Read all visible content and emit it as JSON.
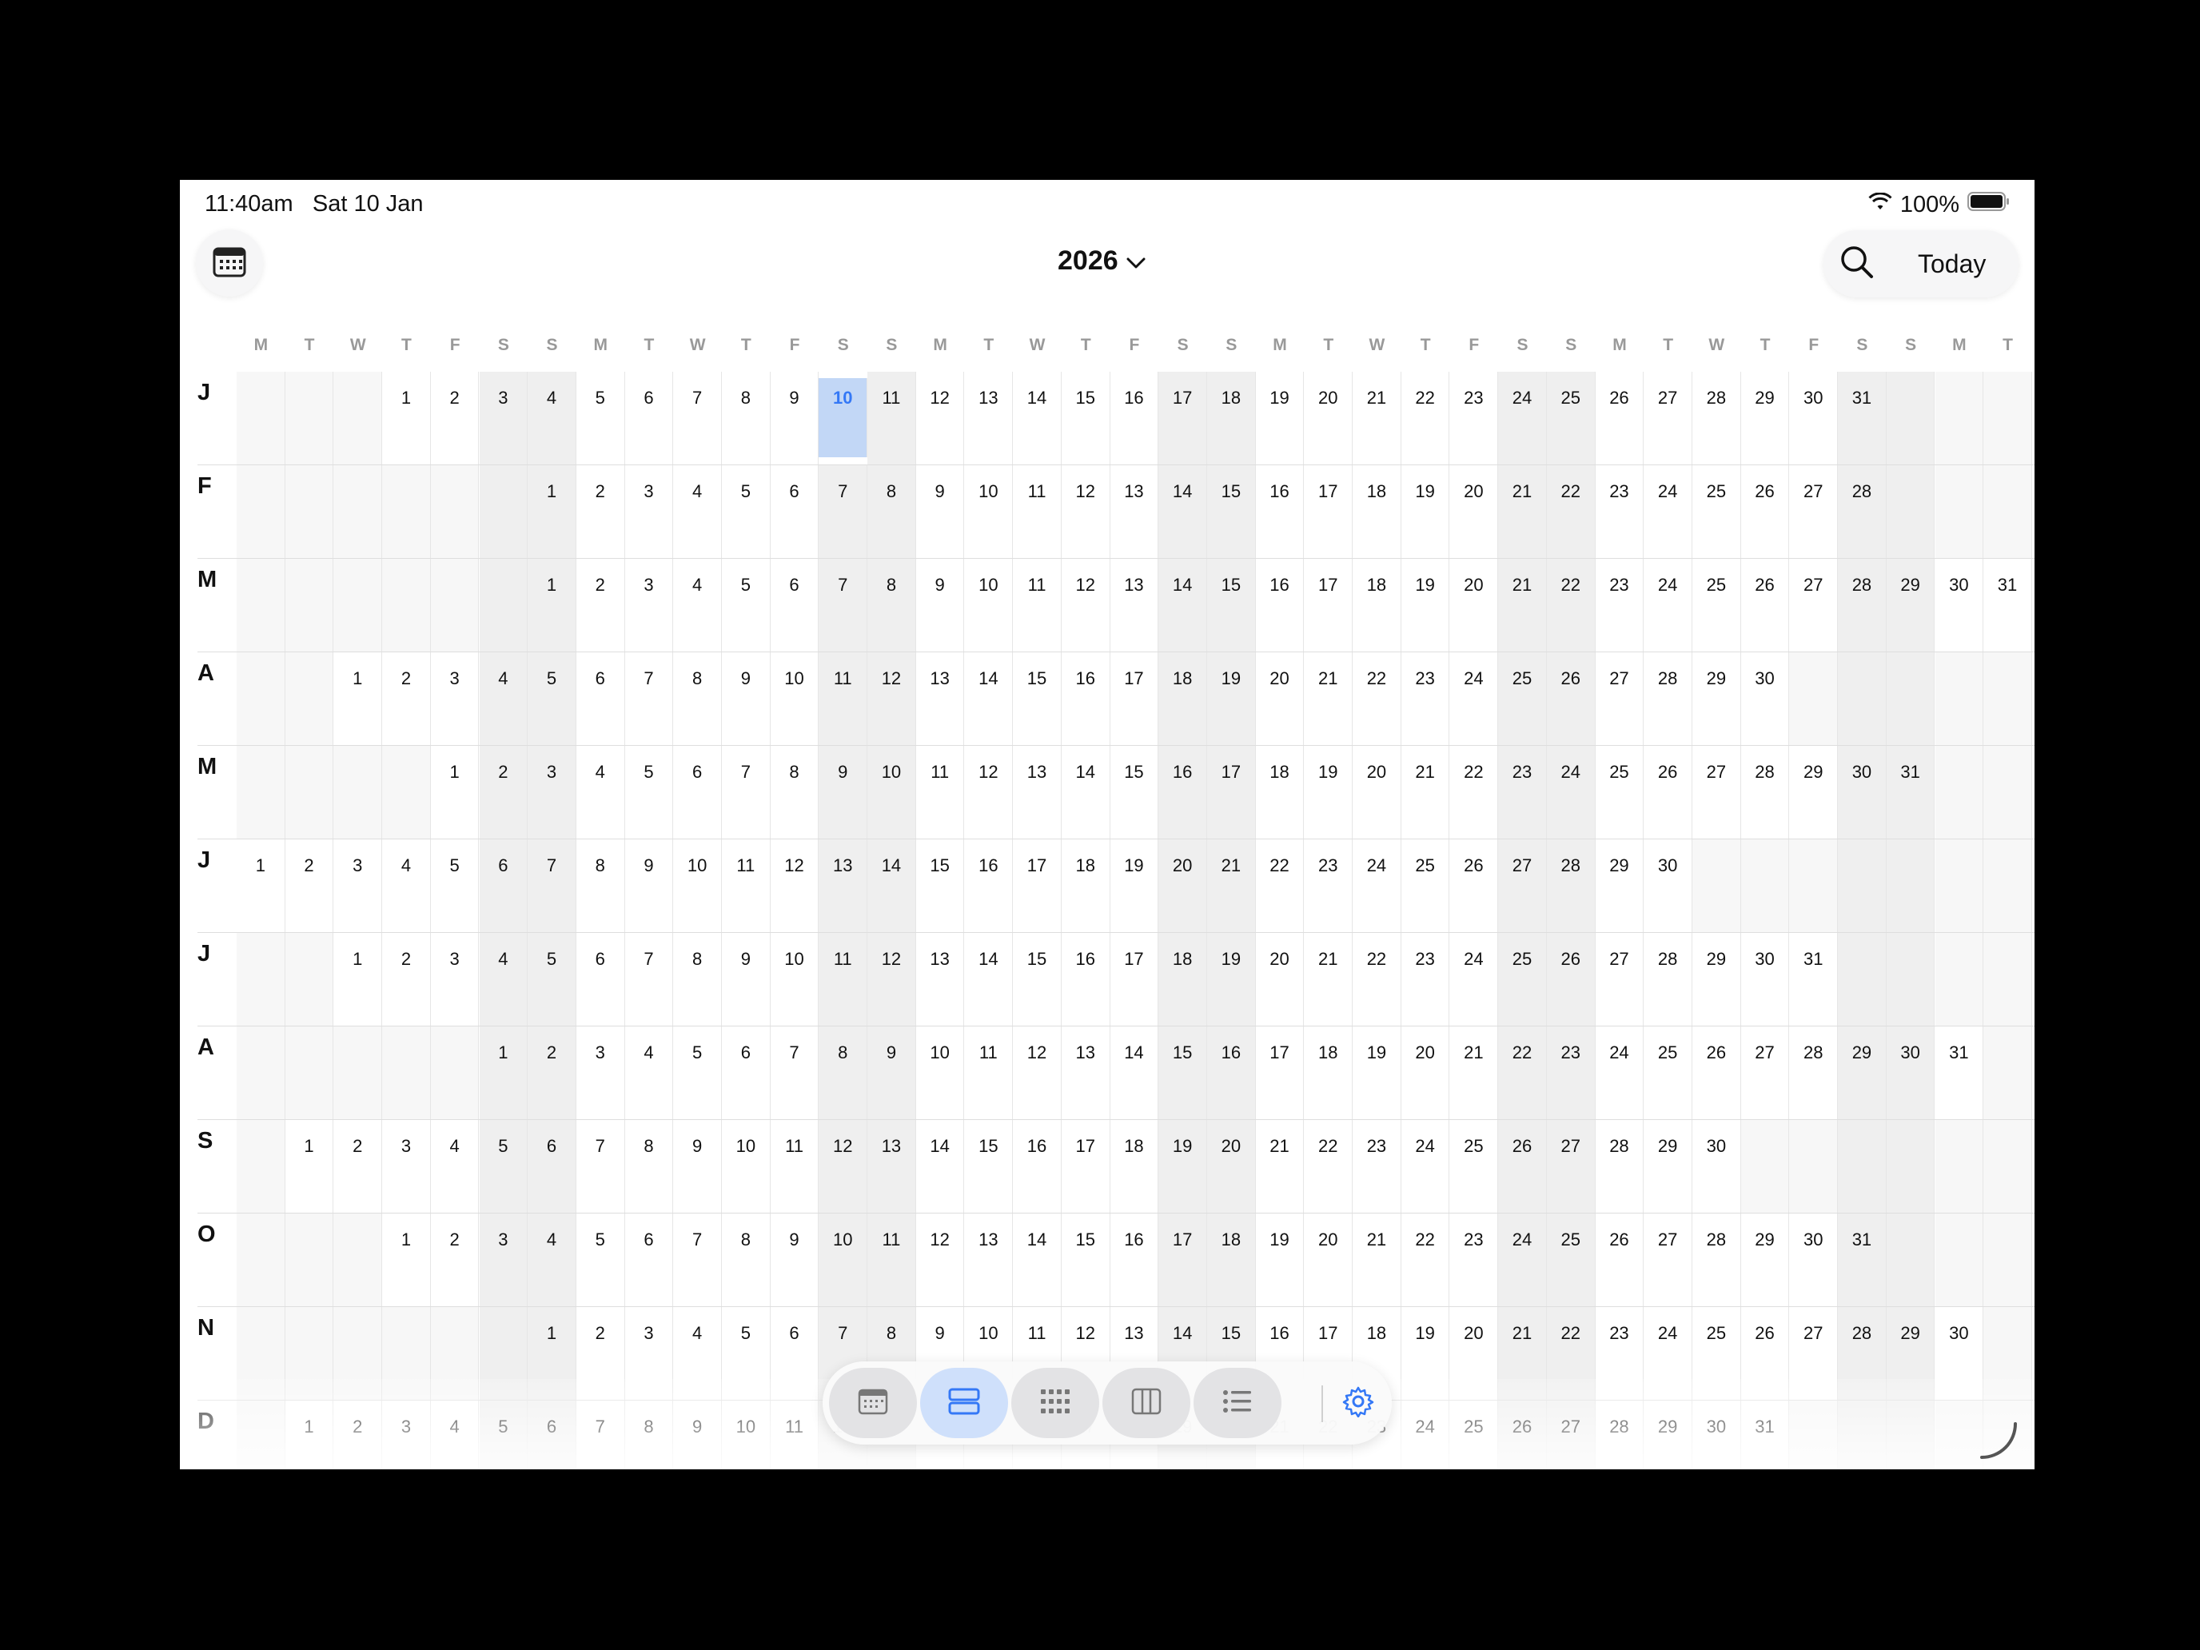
{
  "status_bar": {
    "time": "11:40am",
    "date": "Sat 10 Jan",
    "battery": "100%"
  },
  "header": {
    "year": "2026",
    "today_label": "Today"
  },
  "weekday_headers": [
    "M",
    "T",
    "W",
    "T",
    "F",
    "S",
    "S",
    "M",
    "T",
    "W",
    "T",
    "F",
    "S",
    "S",
    "M",
    "T",
    "W",
    "T",
    "F",
    "S",
    "S",
    "M",
    "T",
    "W",
    "T",
    "F",
    "S",
    "S",
    "M",
    "T",
    "W",
    "T",
    "F",
    "S",
    "S",
    "M",
    "T"
  ],
  "months": [
    {
      "label": "J",
      "offset": 3,
      "days": 31
    },
    {
      "label": "F",
      "offset": 6,
      "days": 28
    },
    {
      "label": "M",
      "offset": 6,
      "days": 31
    },
    {
      "label": "A",
      "offset": 2,
      "days": 30
    },
    {
      "label": "M",
      "offset": 4,
      "days": 31
    },
    {
      "label": "J",
      "offset": 0,
      "days": 30
    },
    {
      "label": "J",
      "offset": 2,
      "days": 31
    },
    {
      "label": "A",
      "offset": 5,
      "days": 31
    },
    {
      "label": "S",
      "offset": 1,
      "days": 30
    },
    {
      "label": "O",
      "offset": 3,
      "days": 31
    },
    {
      "label": "N",
      "offset": 6,
      "days": 30
    },
    {
      "label": "D",
      "offset": 1,
      "days": 31
    }
  ],
  "today": {
    "month_index": 0,
    "day": 10
  },
  "toolbar": {
    "icons": [
      "calendar-view-icon",
      "year-rows-icon",
      "grid-view-icon",
      "columns-view-icon",
      "list-view-icon"
    ],
    "active_index": 1,
    "settings_icon": "gear-icon"
  },
  "colors": {
    "accent": "#3478f6",
    "today_bg": "#c2d7f6",
    "weekend_bg": "#efefef"
  }
}
